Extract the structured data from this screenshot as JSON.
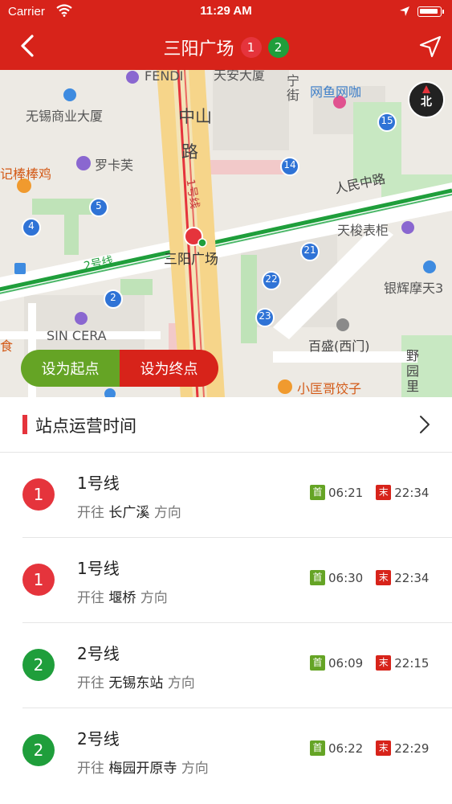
{
  "status": {
    "carrier": "Carrier",
    "time": "11:29 AM"
  },
  "nav": {
    "title": "三阳广场",
    "badges": [
      {
        "label": "1",
        "color": "#E5343C"
      },
      {
        "label": "2",
        "color": "#1F9E3B"
      }
    ]
  },
  "map": {
    "labels": {
      "fendi": "FENDI",
      "tianan": "天安大厦",
      "ning": "宁",
      "jie": "街",
      "wangyu": "网鱼网咖",
      "wuxi_commerce": "无锡商业大厦",
      "zhongshan": "中山",
      "lu": "路",
      "luokafu": "罗卡芙",
      "jibangbangji": "记棒棒鸡",
      "renminzhonglu": "人民中路",
      "line1_vertical": "1号线",
      "tianjun": "天梭表柜",
      "sanyang": "三阳广场",
      "line2_label": "2号线",
      "yinhui": "银辉摩天3",
      "sincera": "SIN CERA",
      "baisheng": "百盛(西门)",
      "shi": "食",
      "yeyuanli": "野园里",
      "xiaokuang": "小匡哥饺子"
    },
    "pins": [
      "15",
      "14",
      "5",
      "4",
      "21",
      "22",
      "2",
      "23"
    ],
    "compass": "北"
  },
  "buttons": {
    "set_start": "设为起点",
    "set_end": "设为终点"
  },
  "section": {
    "title": "站点运营时间"
  },
  "rows": [
    {
      "line": "1",
      "name": "1号线",
      "prefix": "开往",
      "dest": "长广溪",
      "suffix": "方向",
      "first_tag": "首",
      "first": "06:21",
      "last_tag": "末",
      "last": "22:34",
      "color": "#E5343C"
    },
    {
      "line": "1",
      "name": "1号线",
      "prefix": "开往",
      "dest": "堰桥",
      "suffix": "方向",
      "first_tag": "首",
      "first": "06:30",
      "last_tag": "末",
      "last": "22:34",
      "color": "#E5343C"
    },
    {
      "line": "2",
      "name": "2号线",
      "prefix": "开往",
      "dest": "无锡东站",
      "suffix": "方向",
      "first_tag": "首",
      "first": "06:09",
      "last_tag": "末",
      "last": "22:15",
      "color": "#1F9E3B"
    },
    {
      "line": "2",
      "name": "2号线",
      "prefix": "开往",
      "dest": "梅园开原寺",
      "suffix": "方向",
      "first_tag": "首",
      "first": "06:22",
      "last_tag": "末",
      "last": "22:29",
      "color": "#1F9E3B"
    }
  ],
  "colors": {
    "brand_red": "#D7231A",
    "line1": "#E5343C",
    "line2": "#1F9E3B",
    "start_green": "#65A425"
  }
}
